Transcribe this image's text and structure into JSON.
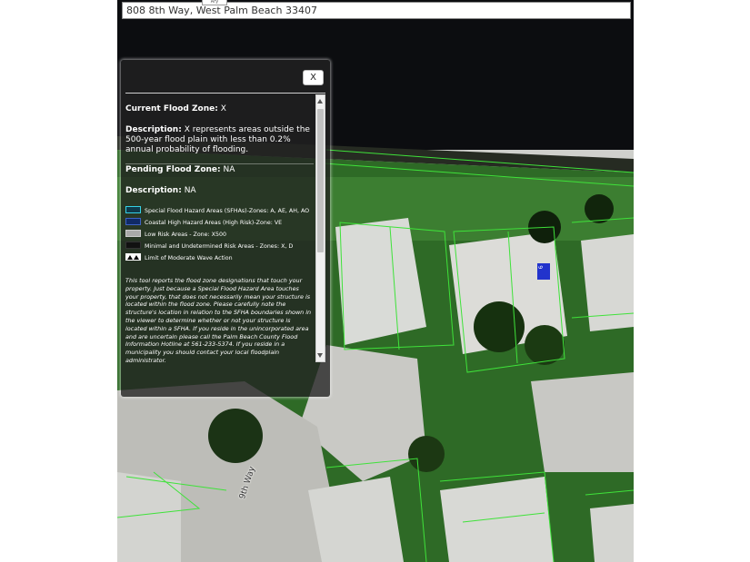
{
  "search": {
    "value": "808 8th Way, West Palm Beach 33407"
  },
  "top_tab": {
    "label": "Ary"
  },
  "map": {
    "street_label": "9th Way",
    "house_badge": "9",
    "colors": {
      "parcel_lines": "#3fe23a",
      "water": "#0c0d10",
      "grass": "#3b7a2e"
    }
  },
  "popup": {
    "close_label": "X",
    "current_zone": {
      "label": "Current Flood Zone:",
      "value": "X"
    },
    "description": {
      "label": "Description:",
      "value": "X represents areas outside the 500-year flood plain with less than 0.2% annual probability of flooding."
    },
    "pending_zone": {
      "label": "Pending Flood Zone:",
      "value": "NA"
    },
    "pending_description": {
      "label": "Description:",
      "value": "NA"
    },
    "legend": [
      {
        "label": "Special Flood Hazard Areas (SFHAs)-Zones: A, AE, AH, AO",
        "swatch_fill": "#0f3a4a",
        "swatch_border": "#35d1e6"
      },
      {
        "label": "Coastal High Hazard Areas (High Risk)-Zone: VE",
        "swatch_fill": "#102a66",
        "swatch_border": "#3d62c4"
      },
      {
        "label": "Low Risk Areas - Zone: X500",
        "swatch_fill": "#a9a9a9",
        "swatch_border": "#cccccc"
      },
      {
        "label": "Minimal and Undetermined Risk Areas - Zones: X, D",
        "swatch_fill": "#111111",
        "swatch_border": "#333333"
      },
      {
        "label": "Limit of Moderate Wave Action",
        "swatch_fill": "#ffffff",
        "swatch_border": "#ffffff"
      }
    ],
    "disclaimer": "This tool reports the flood zone designations that touch your property. Just because a Special Flood Hazard Area touches your property, that does not necessarily mean your structure is located within the flood zone. Please carefully note the structure's location in relation to the SFHA boundaries shown in the viewer to determine whether or not your structure is located within a SFHA. If you reside in the unincorporated area and are uncertain please call the Palm Beach County Flood Information Hotline at 561-233-5374. If you reside in a municipality you should contact your local floodplain administrator."
  }
}
